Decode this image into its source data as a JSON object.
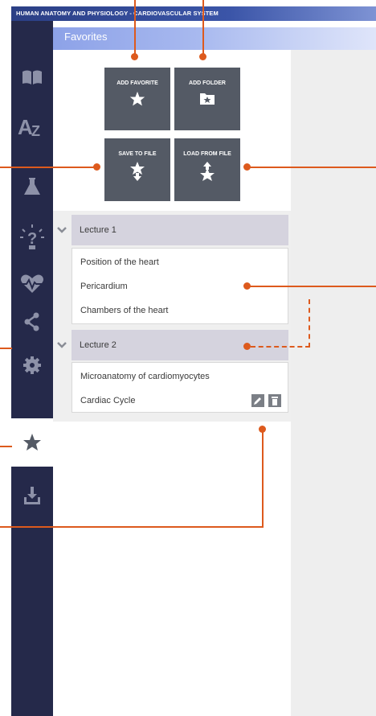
{
  "app": {
    "title": "HUMAN ANATOMY AND PHYSIOLOGY - CARDIOVASCULAR SYSTEM"
  },
  "panel": {
    "title": "Favorites"
  },
  "sidebar": {
    "items": [
      {
        "icon": "book-icon",
        "active": false
      },
      {
        "icon": "az-icon",
        "active": false
      },
      {
        "icon": "flask-icon",
        "active": false
      },
      {
        "icon": "lightbulb-question-icon",
        "active": false
      },
      {
        "icon": "heartbeat-icon",
        "active": false
      },
      {
        "icon": "share-icon",
        "active": false
      },
      {
        "icon": "gear-icon",
        "active": false
      },
      {
        "icon": "star-icon",
        "active": true
      },
      {
        "icon": "download-icon",
        "active": false
      }
    ]
  },
  "tiles": {
    "add_favorite": "ADD FAVORITE",
    "add_folder": "ADD FOLDER",
    "save_to_file": "SAVE TO FILE",
    "load_from_file": "LOAD FROM FILE"
  },
  "groups": [
    {
      "title": "Lecture 1",
      "items": [
        "Position of the heart",
        "Pericardium",
        "Chambers of the heart"
      ]
    },
    {
      "title": "Lecture 2",
      "items": [
        "Microanatomy of cardiomyocytes",
        "Cardiac Cycle"
      ]
    }
  ],
  "colors": {
    "sidebar": "#25294a",
    "tile": "#545a65",
    "accent": "#dd5a1d",
    "header": "#8da2e8"
  }
}
